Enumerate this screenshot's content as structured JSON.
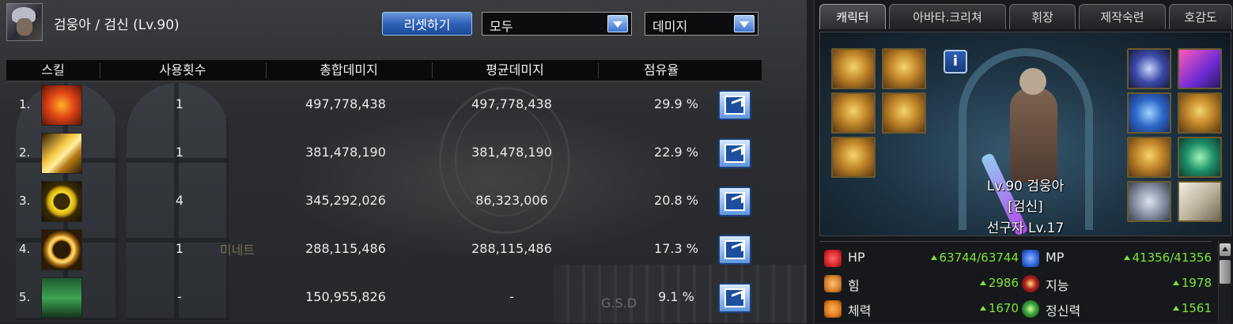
{
  "header": {
    "character_title": "검웅아 / 검신 (Lv.90)",
    "reset_label": "리셋하기",
    "filter_value": "모두",
    "metric_value": "데미지"
  },
  "table": {
    "columns": [
      "스킬",
      "사용횟수",
      "총합데미지",
      "평균데미지",
      "점유율"
    ],
    "rows": [
      {
        "rank": "1.",
        "uses": "1",
        "total": "497,778,438",
        "average": "497,778,438",
        "share": "29.9 %",
        "icon": "crimson-burst-skill-icon"
      },
      {
        "rank": "2.",
        "uses": "1",
        "total": "381,478,190",
        "average": "381,478,190",
        "share": "22.9 %",
        "icon": "golden-slash-skill-icon"
      },
      {
        "rank": "3.",
        "uses": "4",
        "total": "345,292,026",
        "average": "86,323,006",
        "share": "20.8 %",
        "icon": "yellow-crescent-skill-icon"
      },
      {
        "rank": "4.",
        "uses": "1",
        "total": "288,115,486",
        "average": "288,115,486",
        "share": "17.3 %",
        "icon": "golden-ring-slash-skill-icon"
      },
      {
        "rank": "5.",
        "uses": "-",
        "total": "150,955,826",
        "average": "-",
        "share": "9.1 %",
        "icon": "green-rune-skill-icon"
      }
    ],
    "share_icon": "export-share-icon"
  },
  "background_text": {
    "t1": "미네트",
    "t2": "G.S.D"
  },
  "right_panel": {
    "tabs": [
      "캐릭터",
      "아바타.크리쳐",
      "휘장",
      "제작숙련",
      "호감도"
    ],
    "active_tab": 0,
    "info_label": "i",
    "character": {
      "level_name": "Lv.90 검웅아",
      "job": "[검신]",
      "pioneer": "선구자 Lv.17"
    },
    "stats": [
      {
        "label": "HP",
        "value": "63744/63744",
        "icon": "heart-icon",
        "color": "#d8252a"
      },
      {
        "label": "MP",
        "value": "41356/41356",
        "icon": "blue-heart-icon",
        "color": "#2c63d9"
      },
      {
        "label": "힘",
        "value": "2986",
        "icon": "strength-arm-icon",
        "color": "#d9822b"
      },
      {
        "label": "지능",
        "value": "1978",
        "icon": "red-eye-icon",
        "color": "#b52222"
      },
      {
        "label": "체력",
        "value": "1670",
        "icon": "vitality-figure-icon",
        "color": "#e07a1f"
      },
      {
        "label": "정신력",
        "value": "1561",
        "icon": "green-eye-icon",
        "color": "#3ca33c"
      }
    ]
  },
  "colors": {
    "accent": "#2f62b7",
    "stat_green": "#7ee33a"
  }
}
